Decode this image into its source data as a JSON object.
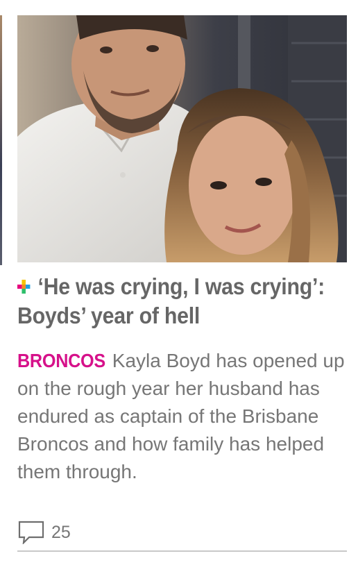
{
  "article": {
    "headline": "‘He was crying, I was crying’: Boyds’ year of hell",
    "tag": "BRONCOS",
    "summary": " Kayla Boyd has opened up on the rough year her husband has endured as captain of the Brisbane Broncos and how family has helped them through.",
    "comment_count": "25",
    "plus_icon": "plus-icon",
    "comment_icon": "speech-bubble-icon"
  },
  "colors": {
    "tag": "#d6118a",
    "headline": "#666666",
    "summary": "#767676",
    "plus_yellow": "#f5c400",
    "plus_pink": "#e6007e",
    "plus_blue": "#1da1e0",
    "plus_green": "#2ebf6b"
  }
}
